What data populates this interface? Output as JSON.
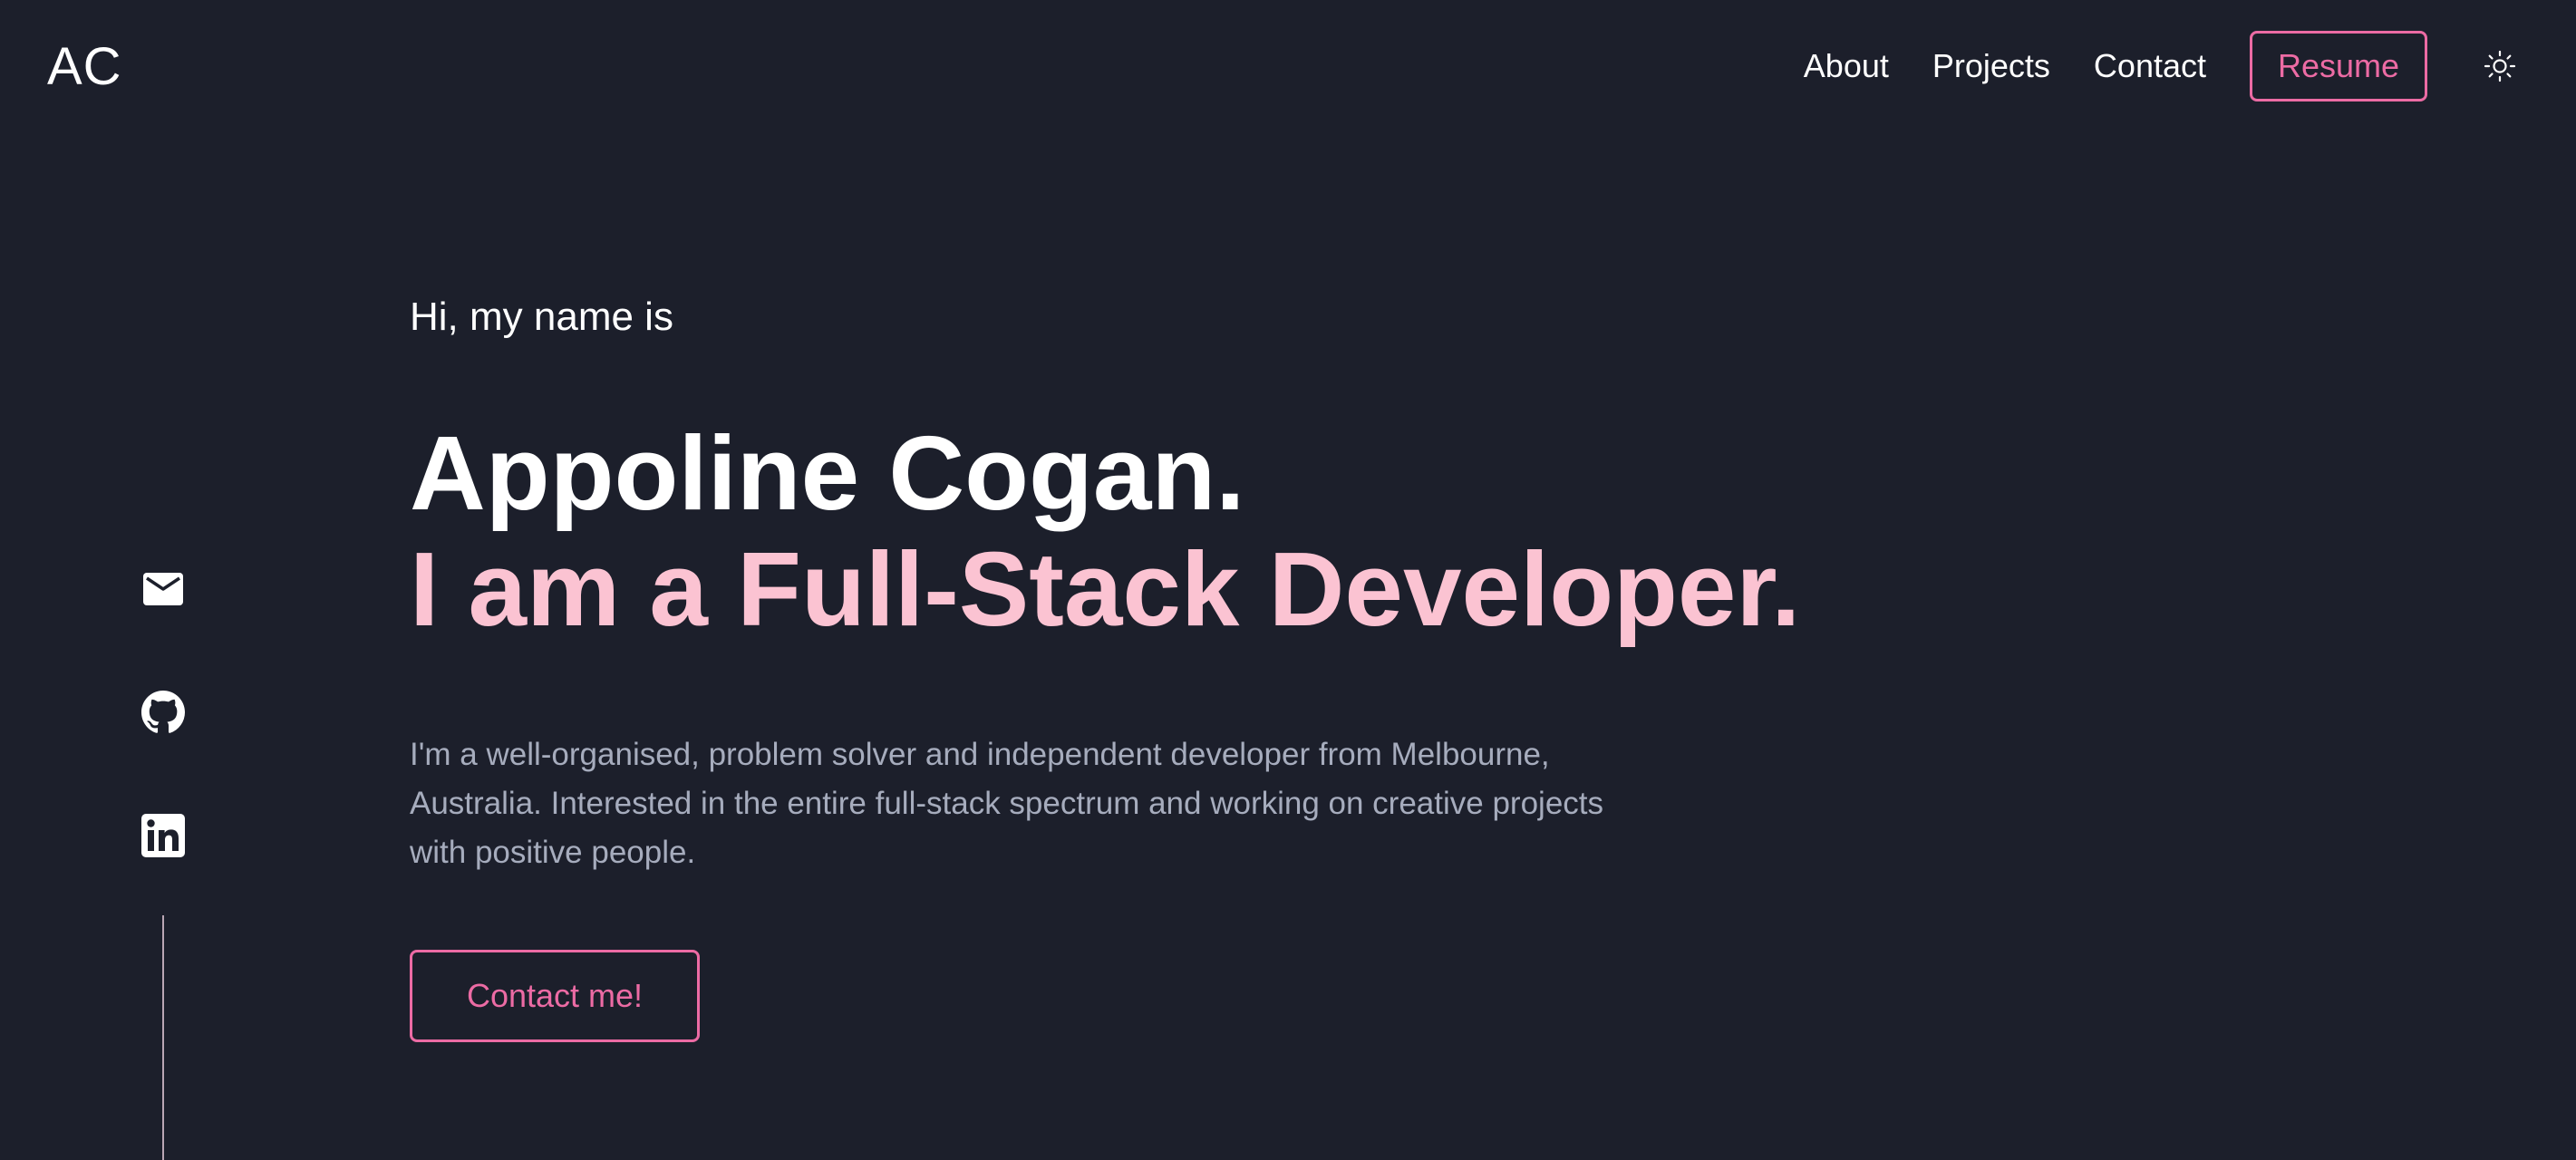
{
  "header": {
    "logo": "AC",
    "nav": [
      {
        "label": "About"
      },
      {
        "label": "Projects"
      },
      {
        "label": "Contact"
      }
    ],
    "resume_label": "Resume",
    "theme_toggle_icon": "sun-icon"
  },
  "social": [
    {
      "icon": "mail-icon"
    },
    {
      "icon": "github-icon"
    },
    {
      "icon": "linkedin-icon"
    }
  ],
  "hero": {
    "greeting": "Hi, my name is",
    "name": "Appoline Cogan.",
    "role": "I am a Full-Stack Developer.",
    "bio": "I'm a well-organised, problem solver and independent developer from Melbourne, Australia. Interested in the entire full-stack spectrum and working on creative projects with positive people.",
    "cta_label": "Contact me!"
  },
  "colors": {
    "background": "#1c1f2b",
    "accent": "#ec6ba4",
    "role_text": "#fbc3d2",
    "muted_text": "#a6acbd"
  }
}
